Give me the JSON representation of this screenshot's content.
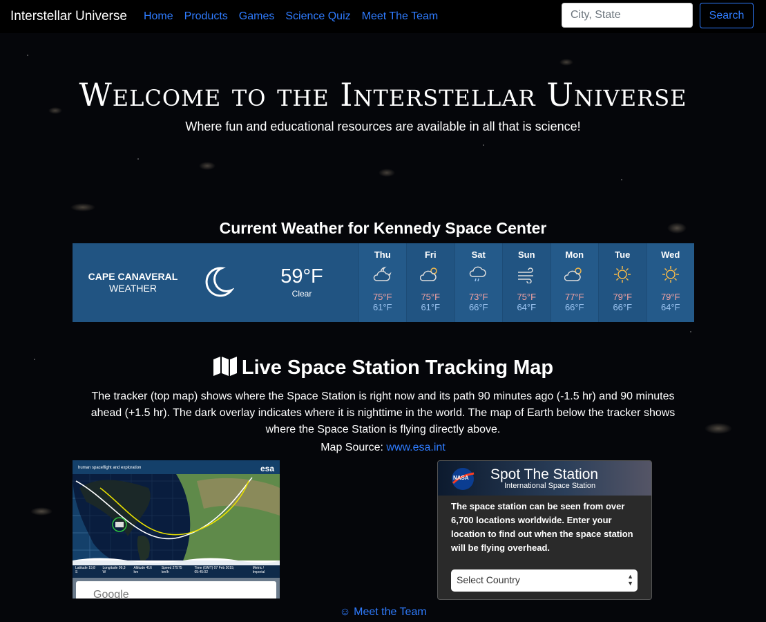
{
  "nav": {
    "brand": "Interstellar Universe",
    "links": [
      "Home",
      "Products",
      "Games",
      "Science Quiz",
      "Meet The Team"
    ],
    "search_placeholder": "City, State",
    "search_button": "Search"
  },
  "hero": {
    "title": "Welcome to the Interstellar Universe",
    "subtitle": "Where fun and educational resources are available in all that is science!"
  },
  "weather": {
    "heading": "Current Weather for Kennedy Space Center",
    "location": "CAPE CANAVERAL",
    "location_sub": "WEATHER",
    "current_temp": "59°F",
    "current_condition": "Clear",
    "current_icon": "moon-icon",
    "forecast": [
      {
        "day": "Thu",
        "icon": "partly-cloudy-night-icon",
        "hi": "75°F",
        "lo": "61°F"
      },
      {
        "day": "Fri",
        "icon": "partly-cloudy-icon",
        "hi": "75°F",
        "lo": "61°F"
      },
      {
        "day": "Sat",
        "icon": "rain-cloud-icon",
        "hi": "73°F",
        "lo": "66°F"
      },
      {
        "day": "Sun",
        "icon": "wind-icon",
        "hi": "75°F",
        "lo": "64°F"
      },
      {
        "day": "Mon",
        "icon": "partly-cloudy-icon",
        "hi": "77°F",
        "lo": "66°F"
      },
      {
        "day": "Tue",
        "icon": "sun-icon",
        "hi": "79°F",
        "lo": "66°F"
      },
      {
        "day": "Wed",
        "icon": "sun-icon",
        "hi": "79°F",
        "lo": "64°F"
      }
    ],
    "colors": {
      "bg": "#215482",
      "hi": "#f4a3a3",
      "lo": "#9cc5f2"
    }
  },
  "tracking": {
    "title": "Live Space Station Tracking Map",
    "description": "The tracker (top map) shows where the Space Station is right now and its path 90 minutes ago (-1.5 hr) and 90 minutes ahead (+1.5 hr). The dark overlay indicates where it is nighttime in the world. The map of Earth below the tracker shows where the Space Station is flying directly above.",
    "source_label": "Map Source:",
    "source_link": "www.esa.int"
  },
  "tracker_map": {
    "caption": "human spaceflight and exploration",
    "logo": "esa",
    "readouts": [
      "Latitude 19,8 S",
      "Longitude 99,3 W",
      "Altitude 416 km",
      "Speed 27575 km/h",
      "Time (GMT) 07 Feb 2019, 05:45:02"
    ],
    "toggle_label": "Metric / Imperial",
    "google_label": "Google"
  },
  "spot": {
    "title": "Spot The Station",
    "subtitle": "International Space Station",
    "logo": "NASA",
    "text": "The space station can be seen from over 6,700 locations worldwide. Enter your location to find out when the space station will be flying overhead.",
    "select_value": "Select Country"
  },
  "footer": {
    "link": "Meet the Team"
  }
}
